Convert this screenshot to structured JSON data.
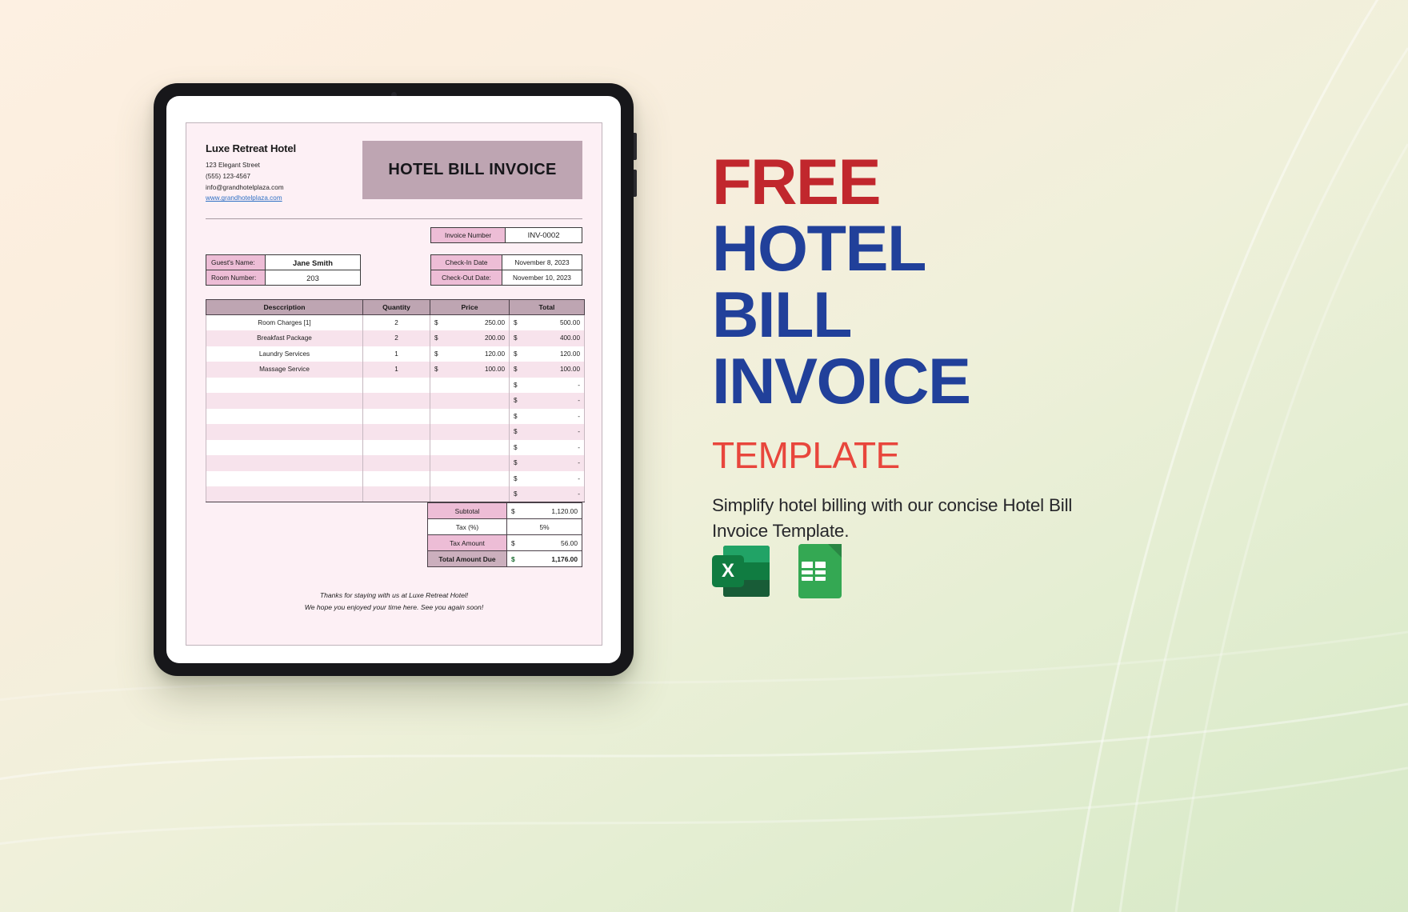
{
  "promo": {
    "line_free": "FREE",
    "line_hotel": "HOTEL",
    "line_bill": "BILL",
    "line_invoice": "INVOICE",
    "line_template": "TEMPLATE",
    "description": "Simplify hotel billing with our concise Hotel Bill Invoice Template.",
    "color_free": "#C1272D",
    "color_blue": "#21409A",
    "color_template": "#E8463C"
  },
  "app_icons": [
    {
      "name": "microsoft-excel",
      "label": "X"
    },
    {
      "name": "google-sheets",
      "label": ""
    }
  ],
  "invoice": {
    "company": {
      "name": "Luxe Retreat Hotel",
      "address": "123 Elegant Street",
      "phone": "(555) 123-4567",
      "email": "info@grandhotelplaza.com",
      "website": "www.grandhotelplaza.com"
    },
    "banner_title": "HOTEL BILL INVOICE",
    "meta": {
      "invoice_number_label": "Invoice Number",
      "invoice_number_value": "INV-0002",
      "guest_name_label": "Guest's Name:",
      "guest_name_value": "Jane Smith",
      "room_number_label": "Room Number:",
      "room_number_value": "203",
      "check_in_label": "Check-In Date",
      "check_in_value": "November 8, 2023",
      "check_out_label": "Check-Out Date:",
      "check_out_value": "November 10, 2023"
    },
    "table": {
      "headers": [
        "Desccription",
        "Quantity",
        "Price",
        "Total"
      ],
      "rows": [
        {
          "description": "Room Charges [1]",
          "quantity": "2",
          "price_cur": "$",
          "price": "250.00",
          "total_cur": "$",
          "total": "500.00"
        },
        {
          "description": "Breakfast Package",
          "quantity": "2",
          "price_cur": "$",
          "price": "200.00",
          "total_cur": "$",
          "total": "400.00"
        },
        {
          "description": "Laundry Services",
          "quantity": "1",
          "price_cur": "$",
          "price": "120.00",
          "total_cur": "$",
          "total": "120.00"
        },
        {
          "description": "Massage Service",
          "quantity": "1",
          "price_cur": "$",
          "price": "100.00",
          "total_cur": "$",
          "total": "100.00"
        },
        {
          "description": "",
          "quantity": "",
          "price_cur": "",
          "price": "",
          "total_cur": "$",
          "total": "-"
        },
        {
          "description": "",
          "quantity": "",
          "price_cur": "",
          "price": "",
          "total_cur": "$",
          "total": "-"
        },
        {
          "description": "",
          "quantity": "",
          "price_cur": "",
          "price": "",
          "total_cur": "$",
          "total": "-"
        },
        {
          "description": "",
          "quantity": "",
          "price_cur": "",
          "price": "",
          "total_cur": "$",
          "total": "-"
        },
        {
          "description": "",
          "quantity": "",
          "price_cur": "",
          "price": "",
          "total_cur": "$",
          "total": "-"
        },
        {
          "description": "",
          "quantity": "",
          "price_cur": "",
          "price": "",
          "total_cur": "$",
          "total": "-"
        },
        {
          "description": "",
          "quantity": "",
          "price_cur": "",
          "price": "",
          "total_cur": "$",
          "total": "-"
        },
        {
          "description": "",
          "quantity": "",
          "price_cur": "",
          "price": "",
          "total_cur": "$",
          "total": "-"
        }
      ]
    },
    "summary": {
      "subtotal_label": "Subtotal",
      "subtotal_cur": "$",
      "subtotal_value": "1,120.00",
      "tax_pct_label": "Tax (%)",
      "tax_pct_value": "5%",
      "tax_amount_label": "Tax Amount",
      "tax_amount_cur": "$",
      "tax_amount_value": "56.00",
      "total_due_label": "Total Amount Due",
      "total_due_cur": "$",
      "total_due_value": "1,176.00",
      "color_tax": "#9B1F2B",
      "color_total": "#1C6B31"
    },
    "footer": {
      "line1": "Thanks for staying with us at Luxe Retreat Hotel!",
      "line2": "We hope you enjoyed your time here. See you again soon!"
    }
  }
}
